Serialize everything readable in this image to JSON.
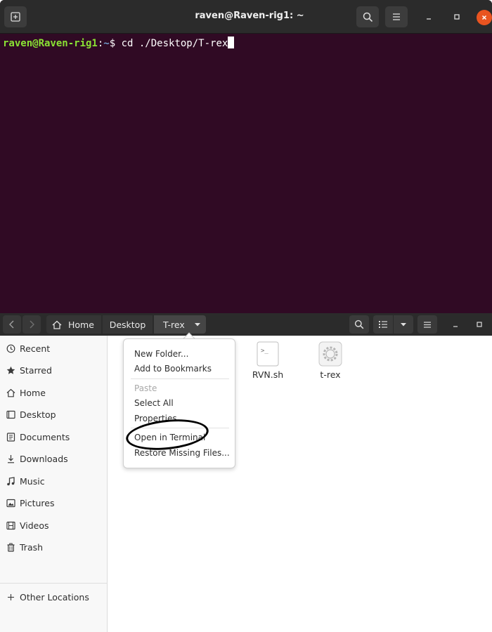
{
  "terminal": {
    "title": "raven@Raven-rig1: ~",
    "prompt_user": "raven@Raven-rig1",
    "prompt_sep": ":",
    "prompt_path": "~",
    "prompt_symbol": "$ ",
    "command": "cd ./Desktop/T-rex",
    "icons": {
      "new_tab": "new-tab-icon",
      "search": "search-icon",
      "menu": "hamburger-menu-icon",
      "minimize": "minimize-icon",
      "maximize": "maximize-icon",
      "close": "close-icon"
    },
    "colors": {
      "background": "#300a24",
      "prompt_user": "#8ae234",
      "prompt_path": "#729fcf",
      "close_button": "#e95420"
    }
  },
  "file_manager": {
    "breadcrumbs": [
      {
        "label": "Home",
        "icon": "home-icon"
      },
      {
        "label": "Desktop"
      },
      {
        "label": "T-rex"
      }
    ],
    "sidebar": [
      {
        "label": "Recent",
        "icon": "clock-icon"
      },
      {
        "label": "Starred",
        "icon": "star-icon"
      },
      {
        "label": "Home",
        "icon": "home-icon"
      },
      {
        "label": "Desktop",
        "icon": "desktop-icon"
      },
      {
        "label": "Documents",
        "icon": "document-icon"
      },
      {
        "label": "Downloads",
        "icon": "download-icon"
      },
      {
        "label": "Music",
        "icon": "music-note-icon"
      },
      {
        "label": "Pictures",
        "icon": "picture-icon"
      },
      {
        "label": "Videos",
        "icon": "film-icon"
      },
      {
        "label": "Trash",
        "icon": "trash-icon"
      },
      {
        "label": "Other Locations",
        "icon": "plus-icon"
      }
    ],
    "files": [
      {
        "name": "RVN.sh",
        "icon": "script-file-icon"
      },
      {
        "name": "t-rex",
        "icon": "executable-gear-icon"
      }
    ],
    "context_menu": {
      "items": [
        {
          "label": "New Folder...",
          "disabled": false
        },
        {
          "label": "Add to Bookmarks",
          "disabled": false
        },
        {
          "label": "Paste",
          "disabled": true
        },
        {
          "label": "Select All",
          "disabled": false
        },
        {
          "label": "Properties",
          "disabled": false
        },
        {
          "label": "Open in Terminal",
          "disabled": false
        },
        {
          "label": "Restore Missing Files...",
          "disabled": false
        }
      ]
    }
  }
}
